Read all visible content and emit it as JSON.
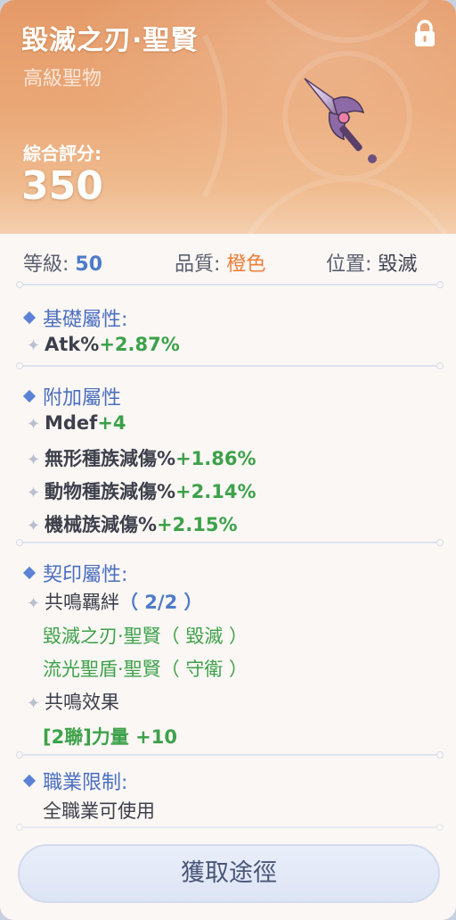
{
  "item": {
    "title": "毀滅之刃·聖賢",
    "rarity": "高級聖物",
    "score_label": "綜合評分:",
    "score_value": "350"
  },
  "meta": {
    "level_label": "等級:",
    "level_value": "50",
    "quality_label": "品質:",
    "quality_value": "橙色",
    "slot_label": "位置:",
    "slot_value": "毀滅"
  },
  "sections": {
    "base": {
      "title": "基礎屬性:",
      "lines": [
        {
          "name": "Atk%",
          "value": "+2.87%"
        }
      ]
    },
    "extra": {
      "title": "附加屬性",
      "lines": [
        {
          "name": "Mdef",
          "value": "+4"
        },
        {
          "name": "無形種族減傷%",
          "value": "+1.86%"
        },
        {
          "name": "動物種族減傷%",
          "value": "+2.14%"
        },
        {
          "name": "機械族減傷%",
          "value": "+2.15%"
        }
      ]
    },
    "seal": {
      "title": "契印屬性:",
      "resonance_label": "共鳴羈絆",
      "resonance_count": "（ 2/2 ）",
      "members": [
        "毀滅之刃·聖賢（ 毀滅 ）",
        "流光聖盾·聖賢（ 守衛 ）"
      ],
      "effect_label": "共鳴效果",
      "effect_value": "[2聯]力量 +10"
    },
    "job": {
      "title": "職業限制:",
      "value": "全職業可使用"
    }
  },
  "actions": {
    "obtain_label": "獲取途徑"
  },
  "colors": {
    "header_orange": "#e49a68",
    "accent_blue": "#4b6fc0",
    "value_green": "#3da14a",
    "quality_orange": "#ee7d3a"
  },
  "icons": [
    "lock-icon",
    "weapon-blade-icon",
    "diamond-bullet-icon",
    "plus-bullet-icon"
  ]
}
